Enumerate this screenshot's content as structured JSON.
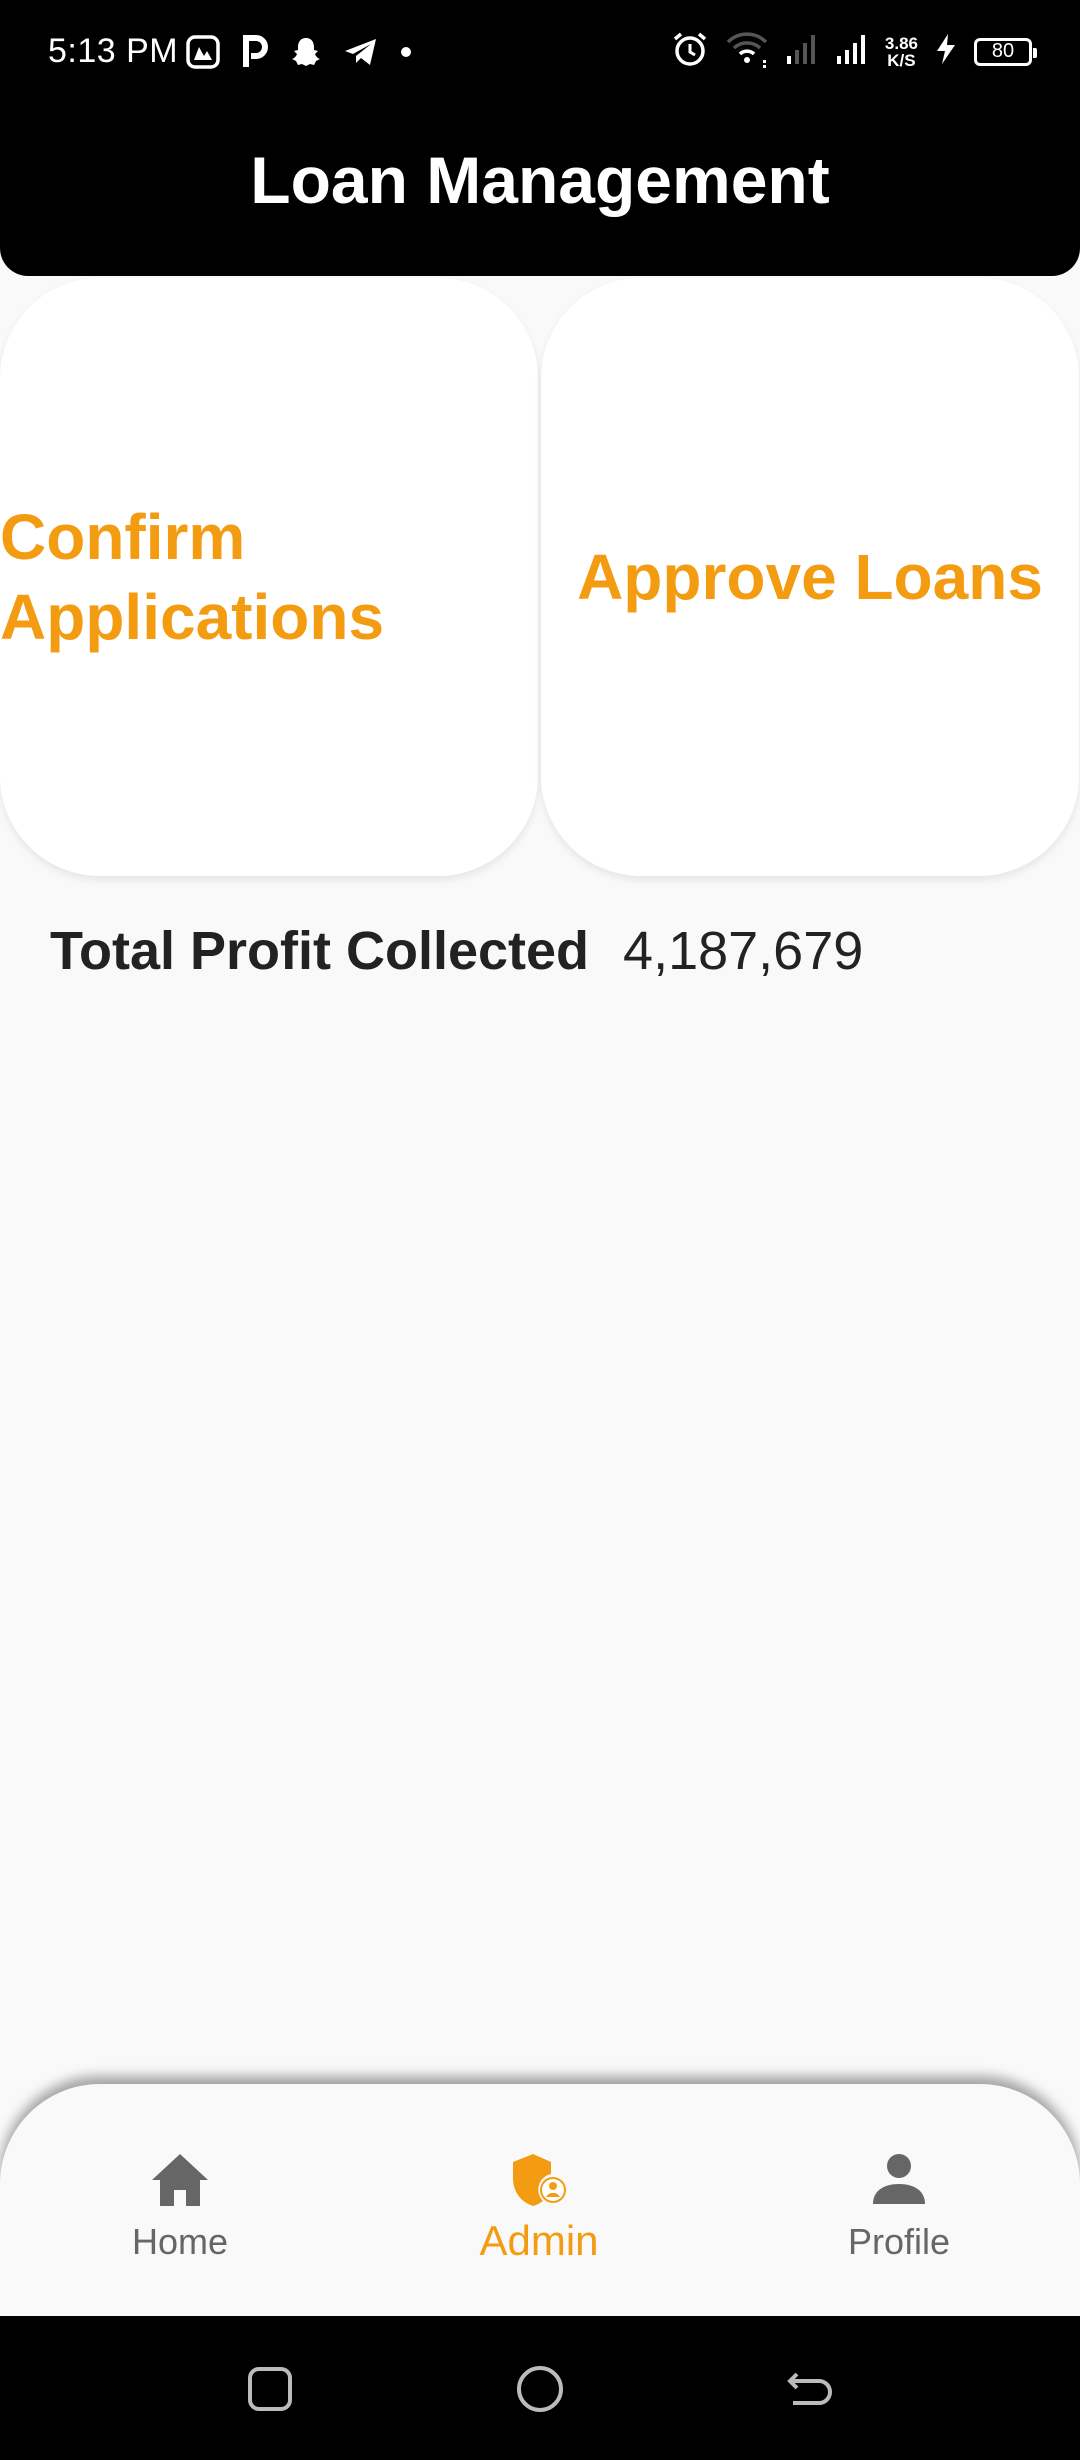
{
  "status_bar": {
    "time": "5:13 PM",
    "net_speed_value": "3.86",
    "net_speed_unit": "K/S",
    "battery_level": "80",
    "left_icons": [
      "gallery-icon",
      "p-icon",
      "snapchat-icon",
      "telegram-icon",
      "dot-icon"
    ],
    "right_icons": [
      "alarm-icon",
      "wifi-icon",
      "signal-icon-1",
      "signal-icon-2",
      "charging-icon"
    ]
  },
  "header": {
    "title": "Loan Management"
  },
  "cards": {
    "confirm": "Confirm Applications",
    "approve": "Approve Loans"
  },
  "profit": {
    "label": "Total Profit Collected",
    "value": "4,187,679"
  },
  "bottom_nav": {
    "items": [
      {
        "label": "Home",
        "icon": "home-icon"
      },
      {
        "label": "Admin",
        "icon": "admin-shield-icon",
        "active": true
      },
      {
        "label": "Profile",
        "icon": "person-icon"
      }
    ]
  },
  "colors": {
    "accent": "#f39c12",
    "header_bg": "#000000",
    "page_bg": "#f9f9f9",
    "inactive_nav": "#666666"
  }
}
